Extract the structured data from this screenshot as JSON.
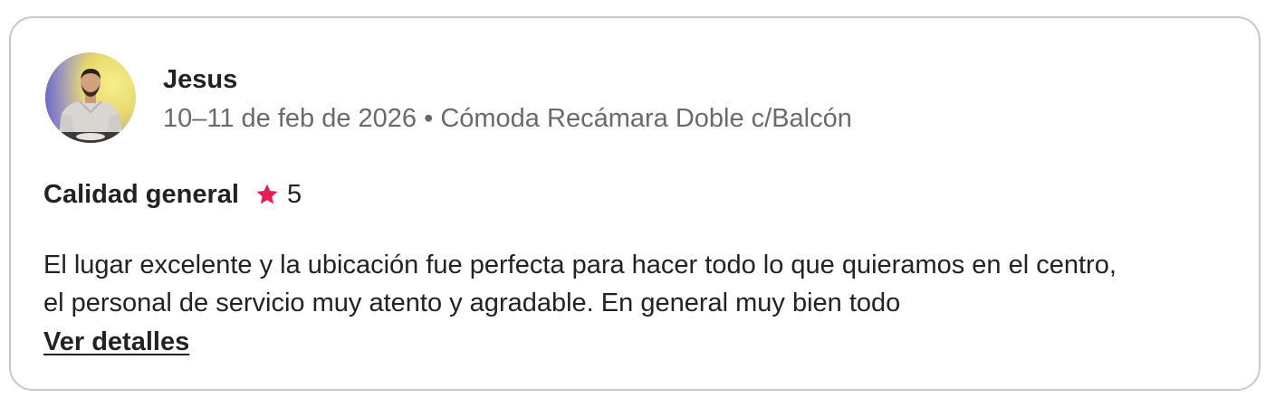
{
  "review": {
    "reviewer_name": "Jesus",
    "stay_info": "10–11 de feb de 2026 • Cómoda Recámara Doble c/Balcón",
    "rating_label": "Calidad general",
    "rating_value": "5",
    "text_lines": [
      "El lugar excelente y la ubicación fue perfecta para hacer todo lo que quieramos en el centro,",
      "el personal de servicio muy atento y agradable. En general muy bien todo"
    ],
    "details_link": "Ver detalles"
  },
  "icons": {
    "star": "star-icon",
    "avatar": "user-photo"
  },
  "colors": {
    "star": "#E51D53",
    "text_primary": "#222222",
    "text_secondary": "#6A6A6A",
    "border": "#C8C8C8"
  }
}
